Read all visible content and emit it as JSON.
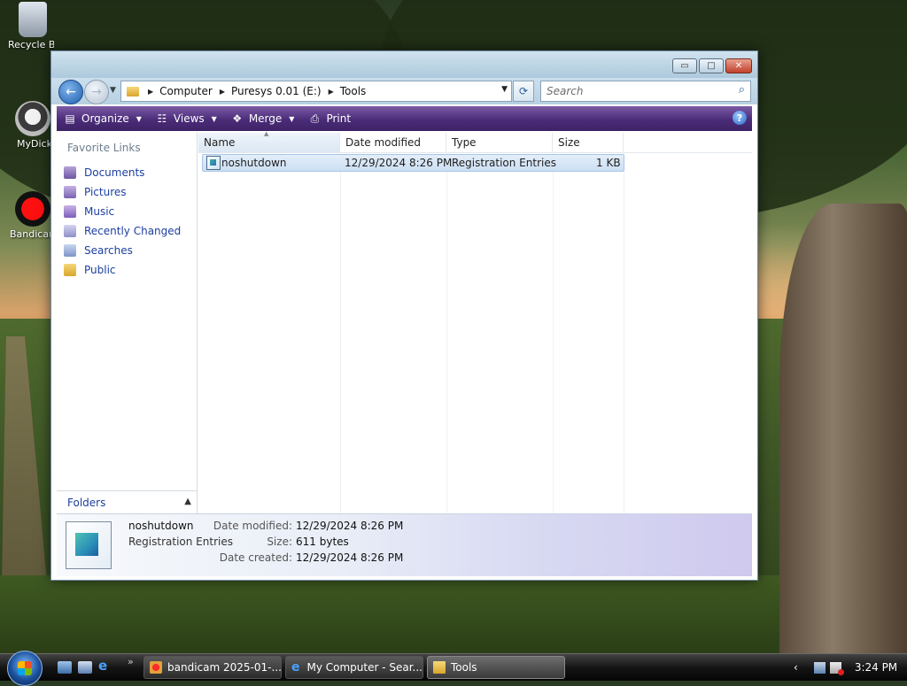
{
  "desktop": {
    "icons": [
      {
        "label": "Recycle Bin"
      },
      {
        "label": "MyDick"
      },
      {
        "label": "Bandicam"
      }
    ]
  },
  "window": {
    "buttons": {
      "minimize": "▭",
      "maximize": "□",
      "close": "✕"
    },
    "breadcrumb": [
      "Computer",
      "Puresys 0.01 (E:)",
      "Tools"
    ],
    "search": {
      "placeholder": "Search"
    },
    "toolbar": {
      "organize": "Organize",
      "views": "Views",
      "merge": "Merge",
      "print": "Print",
      "help": "?"
    },
    "nav": {
      "favorite_links_title": "Favorite Links",
      "items": [
        "Documents",
        "Pictures",
        "Music",
        "Recently Changed",
        "Searches",
        "Public"
      ],
      "folders_label": "Folders"
    },
    "columns": [
      "Name",
      "Date modified",
      "Type",
      "Size"
    ],
    "files": [
      {
        "name": "noshutdown",
        "date_modified": "12/29/2024 8:26 PM",
        "type": "Registration Entries",
        "size": "1 KB"
      }
    ],
    "details": {
      "name": "noshutdown",
      "type": "Registration Entries",
      "date_modified_label": "Date modified:",
      "date_modified": "12/29/2024 8:26 PM",
      "size_label": "Size:",
      "size": "611 bytes",
      "date_created_label": "Date created:",
      "date_created": "12/29/2024 8:26 PM"
    }
  },
  "taskbar": {
    "quick_launch_more": "»",
    "tasks": [
      {
        "label": "bandicam 2025-01-..."
      },
      {
        "label": "My Computer - Sear..."
      },
      {
        "label": "Tools"
      }
    ],
    "tray_chevron": "‹",
    "clock": "3:24 PM"
  },
  "colors": {
    "toolbar_purple": "#4a2c78",
    "link_blue": "#1c3fa0",
    "selection": "#cddff3"
  }
}
